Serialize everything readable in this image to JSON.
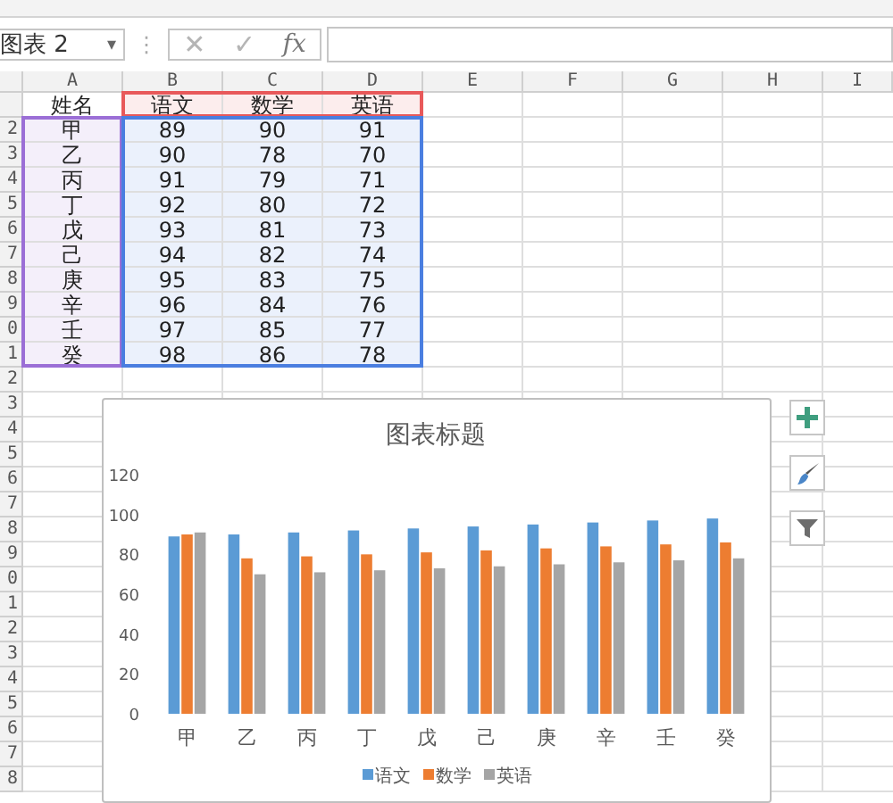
{
  "formula_bar": {
    "name_box": "图表 2",
    "dropdown": "▾",
    "grip": "⋮",
    "cancel": "✕",
    "enter": "✓",
    "function": "fx"
  },
  "sheet": {
    "columns": [
      "A",
      "B",
      "C",
      "D",
      "E",
      "F",
      "G",
      "H",
      "I"
    ],
    "highlight": [
      {
        "kind": "categories",
        "color": "#9b6fd6"
      },
      {
        "kind": "series-names",
        "color": "#e8595a"
      },
      {
        "kind": "values",
        "color": "#4a7ee0"
      }
    ],
    "rows": [
      {
        "cells": [
          "姓名",
          "语文",
          "数学",
          "英语"
        ]
      },
      {
        "header": "2",
        "cells": [
          "甲",
          "89",
          "90",
          "91"
        ]
      },
      {
        "header": "3",
        "cells": [
          "乙",
          "90",
          "78",
          "70"
        ]
      },
      {
        "header": "4",
        "cells": [
          "丙",
          "91",
          "79",
          "71"
        ]
      },
      {
        "header": "5",
        "cells": [
          "丁",
          "92",
          "80",
          "72"
        ]
      },
      {
        "header": "6",
        "cells": [
          "戊",
          "93",
          "81",
          "73"
        ]
      },
      {
        "header": "7",
        "cells": [
          "己",
          "94",
          "82",
          "74"
        ]
      },
      {
        "header": "8",
        "cells": [
          "庚",
          "95",
          "83",
          "75"
        ]
      },
      {
        "header": "9",
        "cells": [
          "辛",
          "96",
          "84",
          "76"
        ]
      },
      {
        "header": "0",
        "cells": [
          "壬",
          "97",
          "85",
          "77"
        ]
      },
      {
        "header": "1",
        "cells": [
          "癸",
          "98",
          "86",
          "78"
        ]
      },
      {
        "header": "2"
      },
      {
        "header": "3"
      },
      {
        "header": "4"
      },
      {
        "header": "5"
      },
      {
        "header": "6"
      },
      {
        "header": "7"
      },
      {
        "header": "8"
      },
      {
        "header": "9"
      },
      {
        "header": "0"
      },
      {
        "header": "1"
      },
      {
        "header": "2"
      },
      {
        "header": "3"
      },
      {
        "header": "4"
      },
      {
        "header": "5"
      },
      {
        "header": "6"
      },
      {
        "header": "7"
      },
      {
        "header": "8"
      }
    ]
  },
  "chart": {
    "chart_data": {
      "type": "bar",
      "title": "图表标题",
      "categories": [
        "甲",
        "乙",
        "丙",
        "丁",
        "戊",
        "己",
        "庚",
        "辛",
        "壬",
        "癸"
      ],
      "series": [
        {
          "name": "语文",
          "color": "#5b9bd5",
          "values": [
            89,
            90,
            91,
            92,
            93,
            94,
            95,
            96,
            97,
            98
          ]
        },
        {
          "name": "数学",
          "color": "#ed7d31",
          "values": [
            90,
            78,
            79,
            80,
            81,
            82,
            83,
            84,
            85,
            86
          ]
        },
        {
          "name": "英语",
          "color": "#a5a5a5",
          "values": [
            91,
            70,
            71,
            72,
            73,
            74,
            75,
            76,
            77,
            78
          ]
        }
      ],
      "ylim": [
        0,
        120
      ],
      "yticks": [
        0,
        20,
        40,
        60,
        80,
        100,
        120
      ],
      "legend": "bottom"
    }
  }
}
